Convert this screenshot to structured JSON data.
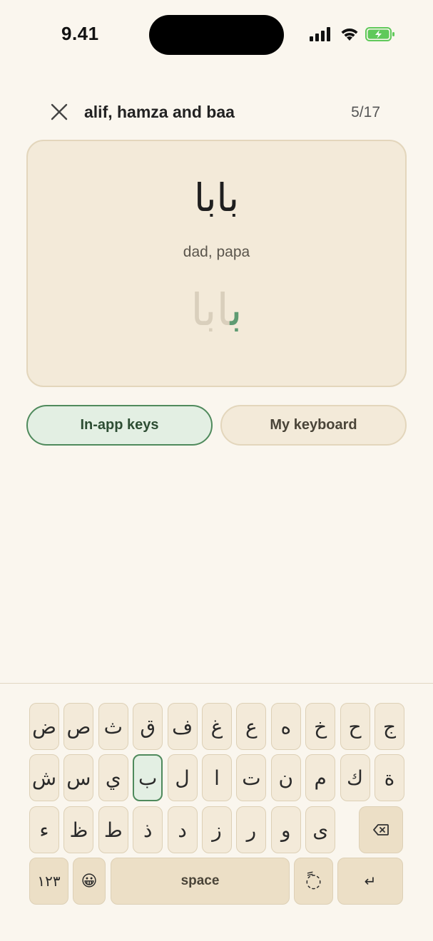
{
  "status": {
    "time": "9.41"
  },
  "header": {
    "title": "alif, hamza and baa",
    "progress": "5/17"
  },
  "card": {
    "word": "بابا",
    "meaning": "dad, papa",
    "answer_typed": "ب",
    "answer_pending": "ابا"
  },
  "toggles": {
    "inapp_label": "In-app keys",
    "mykeyboard_label": "My keyboard"
  },
  "keyboard": {
    "row1": [
      "ض",
      "ص",
      "ث",
      "ق",
      "ف",
      "غ",
      "ع",
      "ه",
      "خ",
      "ح",
      "ج"
    ],
    "row2": [
      "ش",
      "س",
      "ي",
      "ب",
      "ل",
      "ا",
      "ت",
      "ن",
      "م",
      "ك",
      "ة"
    ],
    "row3": [
      "ء",
      "ظ",
      "ط",
      "ذ",
      "د",
      "ز",
      "ر",
      "و",
      "ى"
    ],
    "numbers_label": "١٢٣",
    "emoji_label": "😀",
    "space_label": "space",
    "tanween_label": "◌ً",
    "return_label": "↵",
    "highlighted_key": "ب"
  },
  "colors": {
    "accent": "#4f8a5c",
    "card_bg": "#f3ead9",
    "page_bg": "#faf6ee",
    "battery": "#5fc95a"
  }
}
